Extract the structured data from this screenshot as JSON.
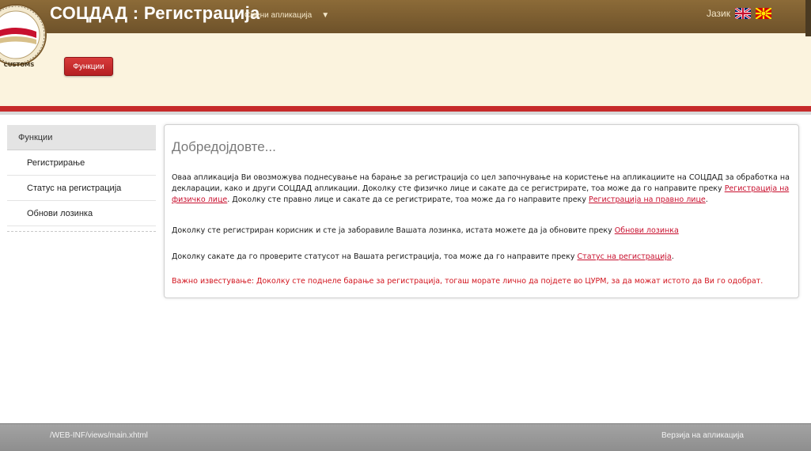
{
  "header": {
    "title": "СОЦДАД : Регистрација",
    "switch_app_label": "Смени апликација",
    "language_label": "Јазик",
    "functions_button": "Функции",
    "logo_text": "MACEDONIA • CUSTOMS"
  },
  "sidebar": {
    "heading": "Функции",
    "items": [
      {
        "label": "Регистрирање"
      },
      {
        "label": "Статус на регистрација"
      },
      {
        "label": "Обнови лозинка"
      }
    ]
  },
  "main": {
    "welcome": "Добредојдовте...",
    "p1_text_a": "Оваа апликација Ви овозможува поднесување на барање за регистрација со цел започнување на користење на апликациите на СОЦДАД за обработка на декларации, како и други СОЦДАД апликации. Доколку сте физичко лице и сакате да се регистрирате, тоа може да го направите преку ",
    "p1_link_a": "Регистрација на физичко лице",
    "p1_text_b": ". Доколку сте правно лице и сакате да се регистрирате, тоа може да го направите преку ",
    "p1_link_b": "Регистрација на правно лице",
    "p1_text_c": ".",
    "p2_text": "Доколку сте регистриран корисник и сте ја заборавиле Вашата лозинка, истата можете да ја обновите преку ",
    "p2_link": "Обнови лозинка",
    "p3_text": "Доколку сакате да го проверите статусот на Вашата регистрација, тоа може да го направите преку ",
    "p3_link": "Статус на регистрација",
    "p3_text_end": ".",
    "notice": "Важно известување: Доколку сте поднеле барање за регистрација, тогаш морате лично да појдете во ЦУРМ, за да можат истото да Ви го одобрат."
  },
  "footer": {
    "path": "/WEB-INF/views/main.xhtml",
    "version_label": "Верзија на апликација"
  },
  "icons": {
    "logo": "customs-emblem-icon",
    "caret": "chevron-down-icon",
    "flag_en": "uk-flag-icon",
    "flag_mk": "macedonia-flag-icon"
  },
  "colors": {
    "title_bar": "#7d5f32",
    "header_bg": "#fbf3de",
    "accent_red": "#c62a2a",
    "link_red": "#c8102e",
    "footer_bg": "#999999"
  }
}
